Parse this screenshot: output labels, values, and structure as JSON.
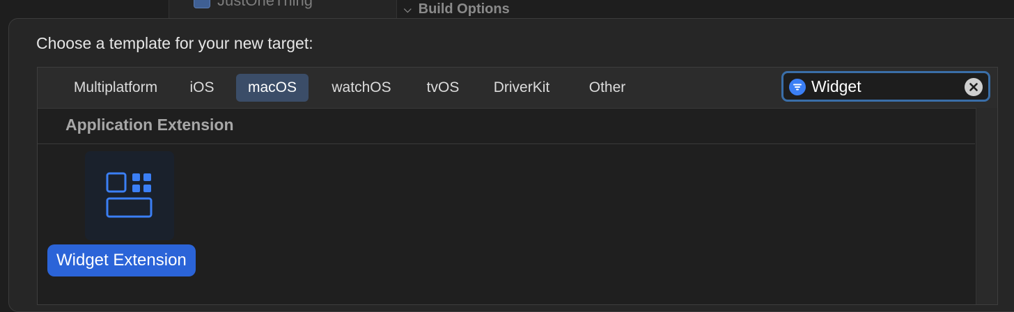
{
  "background": {
    "sidebar_item_label": "JustOneThing",
    "section_label": "Build Options"
  },
  "dialog": {
    "title": "Choose a template for your new target:"
  },
  "platform_tabs": [
    {
      "label": "Multiplatform",
      "selected": false
    },
    {
      "label": "iOS",
      "selected": false
    },
    {
      "label": "macOS",
      "selected": true
    },
    {
      "label": "watchOS",
      "selected": false
    },
    {
      "label": "tvOS",
      "selected": false
    },
    {
      "label": "DriverKit",
      "selected": false
    },
    {
      "label": "Other",
      "selected": false
    }
  ],
  "search": {
    "value": "Widget",
    "icon": "filter-icon",
    "clear_icon": "clear-icon"
  },
  "section": {
    "header": "Application Extension"
  },
  "templates": [
    {
      "label": "Widget Extension",
      "icon": "widget-extension-icon",
      "selected": true
    }
  ],
  "colors": {
    "accent": "#2b64d8",
    "selected_tab": "#3b4d68",
    "search_focus_ring": "#3a6ea8",
    "icon_blue": "#3b7ff5"
  }
}
